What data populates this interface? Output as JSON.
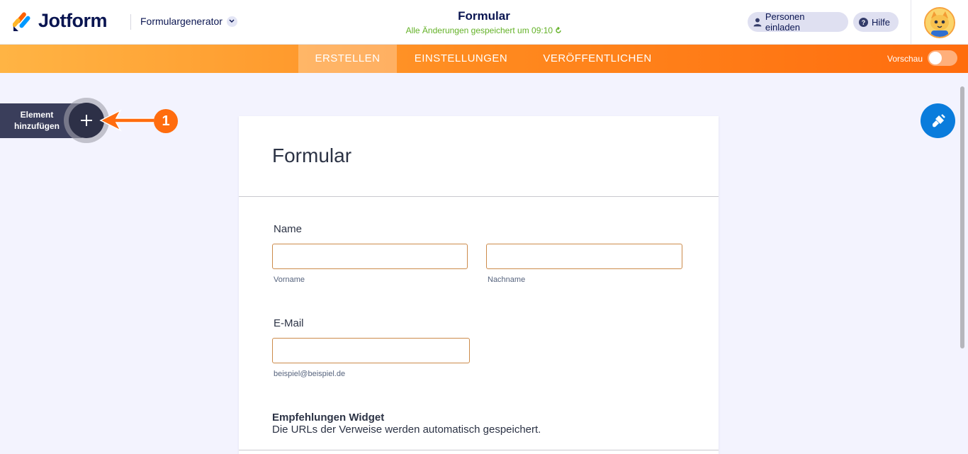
{
  "header": {
    "brand": "Jotform",
    "generator": "Formulargenerator",
    "title": "Formular",
    "saved_status": "Alle Änderungen gespeichert um 09:10",
    "invite_label": "Personen einladen",
    "help_label": "Hilfe"
  },
  "nav": {
    "tabs": [
      {
        "label": "ERSTELLEN",
        "active": true
      },
      {
        "label": "EINSTELLUNGEN",
        "active": false
      },
      {
        "label": "VERÖFFENTLICHEN",
        "active": false
      }
    ],
    "preview_label": "Vorschau",
    "preview_on": false
  },
  "sidebar": {
    "add_element_label": "Element hinzufügen",
    "step_badge": "1"
  },
  "form": {
    "title": "Formular",
    "name_label": "Name",
    "first_name_sub": "Vorname",
    "first_name_value": "",
    "last_name_sub": "Nachname",
    "last_name_value": "",
    "email_label": "E-Mail",
    "email_value": "",
    "email_sub": "beispiel@beispiel.de",
    "widget_title": "Empfehlungen Widget",
    "widget_desc": "Die URLs der Verweise werden automatisch gespeichert."
  },
  "colors": {
    "accent_orange": "#ff6c0e",
    "brand_navy": "#0a1551",
    "saved_green": "#64b228",
    "paint_blue": "#0a7cdc",
    "field_border": "#cc8b4a"
  },
  "icons": {
    "logo": "jotform-logo-icon",
    "generator_dropdown": "chevron-down-icon",
    "saved": "refresh-icon",
    "invite": "user-icon",
    "help": "help-circle-icon",
    "avatar": "cat-avatar-icon",
    "add": "plus-icon",
    "pointer": "arrow-left-icon",
    "paint": "paint-brush-icon"
  }
}
